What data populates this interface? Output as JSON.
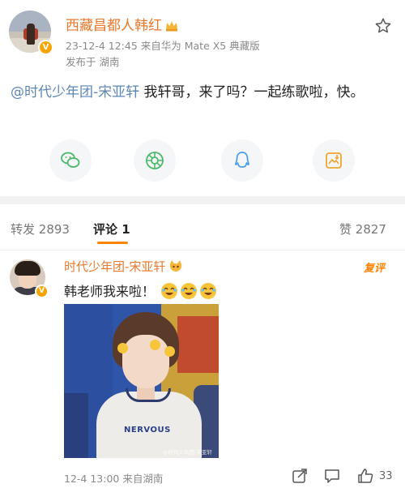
{
  "post": {
    "author": "西藏昌都人韩红",
    "meta": "23-12-4 12:45  来自华为 Mate X5 典藏版",
    "location": "发布于 湖南",
    "mention": "@时代少年团-宋亚轩",
    "text": " 我轩哥，来了吗？一起练歌啦，快。"
  },
  "share_icons": [
    "wechat-icon",
    "moments-icon",
    "qq-icon",
    "save-image-icon"
  ],
  "tabs": {
    "repost_label": "转发",
    "repost_count": "2893",
    "comment_label": "评论",
    "comment_count": "1",
    "like_label": "赞",
    "like_count": "2827"
  },
  "comment": {
    "author": "时代少年团-宋亚轩",
    "reply_label": "复评",
    "text": "韩老师我来啦！",
    "photo_print": "NERVOUS",
    "photo_watermark": "@时代少年团-宋亚轩",
    "meta": "12-4 13:00  来自湖南",
    "like_count": "33"
  },
  "colors": {
    "username": "#e8792b",
    "mention": "#5b86b7",
    "accent": "#ff8200",
    "badge": "#f7a400"
  }
}
